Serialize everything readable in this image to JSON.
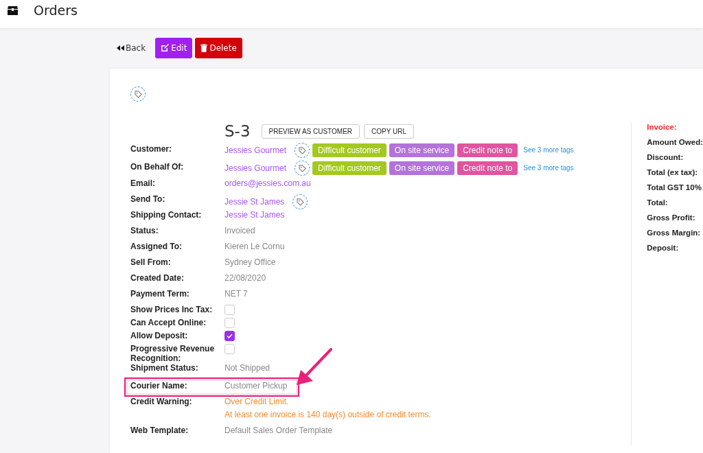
{
  "header": {
    "title": "Orders"
  },
  "toolbar": {
    "back": "Back",
    "edit": "Edit",
    "delete": "Delete"
  },
  "order": {
    "number": "S-3",
    "buttons": [
      "PREVIEW AS CUSTOMER",
      "COPY URL"
    ]
  },
  "fields": [
    {
      "kind": "tags",
      "label": "Customer:",
      "value": "Jessies Gourmet",
      "tag_button": true,
      "tags": [
        {
          "text": "Difficult customer",
          "color": "#a4c91e"
        },
        {
          "text": "On site service",
          "color": "#b373d9"
        },
        {
          "text": "Credit note to",
          "color": "#e0559f"
        }
      ],
      "more": "See 3 more tags",
      "highlighted": false
    },
    {
      "kind": "tags",
      "label": "On Behalf Of:",
      "value": "Jessies Gourmet",
      "tag_button": true,
      "tags": [
        {
          "text": "Difficult customer",
          "color": "#a4c91e"
        },
        {
          "text": "On site service",
          "color": "#b373d9"
        },
        {
          "text": "Credit note to",
          "color": "#e0559f"
        }
      ],
      "more": "See 3 more tags",
      "highlighted": false
    },
    {
      "kind": "link",
      "label": "Email:",
      "value": "orders@jessies.com.au",
      "tag_button": false,
      "highlighted": false
    },
    {
      "kind": "link",
      "label": "Send To:",
      "value": "Jessie St James",
      "tag_button": true,
      "highlighted": false
    },
    {
      "kind": "link",
      "label": "Shipping Contact:",
      "value": "Jessie St James",
      "tag_button": false,
      "highlighted": false
    },
    {
      "kind": "text",
      "label": "Status:",
      "value": "Invoiced",
      "highlighted": false
    },
    {
      "kind": "text",
      "label": "Assigned To:",
      "value": "Kieren Le Cornu",
      "highlighted": false
    },
    {
      "kind": "text",
      "label": "Sell From:",
      "value": "Sydney Office",
      "highlighted": false
    },
    {
      "kind": "text",
      "label": "Created Date:",
      "value": "22/08/2020",
      "highlighted": false
    },
    {
      "kind": "text",
      "label": "Payment Term:",
      "value": "NET 7",
      "highlighted": false
    },
    {
      "kind": "checkbox",
      "label": "Show Prices Inc Tax:",
      "checked": false,
      "highlighted": false
    },
    {
      "kind": "checkbox",
      "label": "Can Accept Online:",
      "checked": false,
      "highlighted": false
    },
    {
      "kind": "checkbox",
      "label": "Allow Deposit:",
      "checked": true,
      "highlighted": false
    },
    {
      "kind": "checkbox",
      "label": "Progressive Revenue Recognition:",
      "checked": false,
      "highlighted": false
    },
    {
      "kind": "text",
      "label": "Shipment Status:",
      "value": "Not Shipped",
      "highlighted": false
    },
    {
      "kind": "text",
      "label": "Courier Name:",
      "value": "Customer Pickup",
      "highlighted": true
    },
    {
      "kind": "warning",
      "label": "Credit Warning:",
      "lines": [
        "Over Credit Limit.",
        "At least one invoice is 140 day(s) outside of credit terms."
      ],
      "highlighted": false
    },
    {
      "kind": "text",
      "label": "Web Template:",
      "value": "Default Sales Order Template",
      "highlighted": false
    }
  ],
  "summary": {
    "title": "Invoice:",
    "items": [
      "Amount Owed:",
      "Discount:",
      "Total (ex tax):",
      "Total GST 10%",
      "Total:",
      "Gross Profit:",
      "Gross Margin:",
      "Deposit:"
    ]
  }
}
